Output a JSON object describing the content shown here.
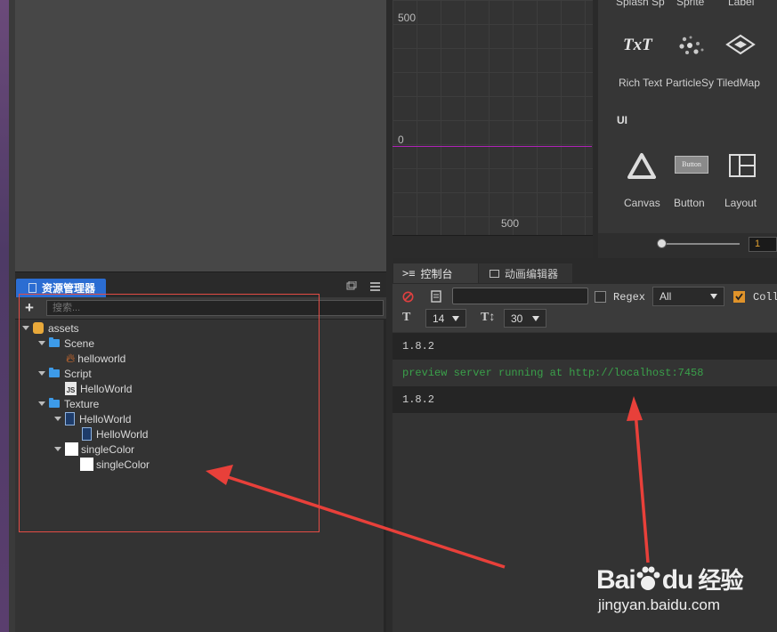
{
  "assets_panel": {
    "tab_title": "资源管理器",
    "search_placeholder": "搜索...",
    "add_label": "+",
    "tree": [
      {
        "label": "assets",
        "icon": "database-icon",
        "expanded": true
      },
      {
        "label": "Scene",
        "icon": "folder-icon",
        "expanded": true
      },
      {
        "label": "helloworld",
        "icon": "fire-icon"
      },
      {
        "label": "Script",
        "icon": "folder-icon",
        "expanded": true
      },
      {
        "label": "HelloWorld",
        "icon": "js-file-icon"
      },
      {
        "label": "Texture",
        "icon": "folder-icon",
        "expanded": true
      },
      {
        "label": "HelloWorld",
        "icon": "image-icon",
        "expanded": true
      },
      {
        "label": "HelloWorld",
        "icon": "image-icon"
      },
      {
        "label": "singleColor",
        "icon": "white-square-icon",
        "expanded": true
      },
      {
        "label": "singleColor",
        "icon": "white-square-icon"
      }
    ]
  },
  "preview_graph": {
    "tick_top": "500",
    "tick_origin": "0",
    "tick_bottom": "500"
  },
  "widget_library": {
    "partial_labels": [
      "Splash Sp",
      "Sprite",
      "Label"
    ],
    "row1": [
      "Rich Text",
      "ParticleSy",
      "TiledMap"
    ],
    "ui_header": "UI",
    "row2": [
      "Canvas",
      "Button",
      "Layout"
    ],
    "button_icon_text": "Button",
    "richtext_icon_text": "TxT",
    "zoom_value": "1"
  },
  "console": {
    "tab_console": "控制台",
    "tab_animation": "动画编辑器",
    "regex_label": "Regex",
    "level_select": "All",
    "collapse_label": "Coll",
    "font_size": "14",
    "line_height": "30",
    "logs": [
      "1.8.2",
      "preview server running at http://localhost:7458",
      "1.8.2"
    ],
    "colors": {
      "info": "#cfcfcf",
      "success": "#3aa04a"
    }
  },
  "watermark": {
    "brand": "Bai",
    "brand_suffix": "du",
    "cn": "经验",
    "url": "jingyan.baidu.com"
  },
  "colors": {
    "tab_active": "#2b6dd2",
    "annotation": "#e34c45",
    "axis_line": "#b022b8"
  }
}
